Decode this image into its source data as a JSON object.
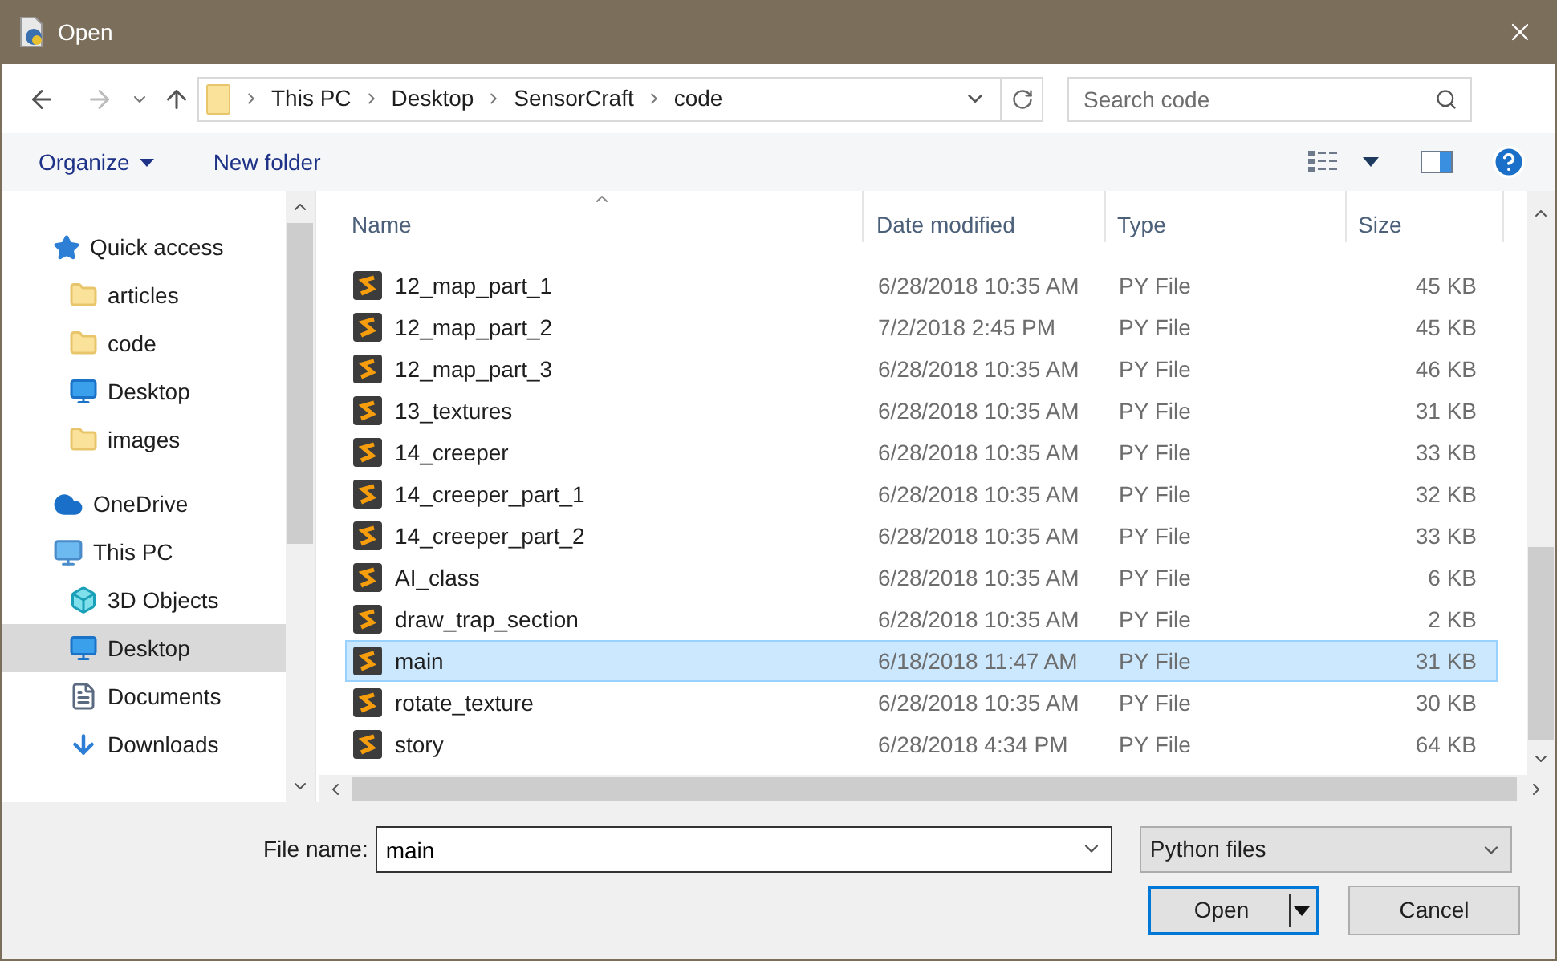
{
  "window": {
    "title": "Open"
  },
  "address": {
    "crumbs": [
      "This PC",
      "Desktop",
      "SensorCraft",
      "code"
    ]
  },
  "search": {
    "placeholder": "Search code"
  },
  "toolbar": {
    "organize": "Organize",
    "new_folder": "New folder"
  },
  "sidebar": {
    "items": [
      {
        "label": "Quick access",
        "kind": "star",
        "selected": false,
        "children": [
          {
            "label": "articles",
            "kind": "folder",
            "selected": false
          },
          {
            "label": "code",
            "kind": "folder",
            "selected": false
          },
          {
            "label": "Desktop",
            "kind": "desktop",
            "selected": false
          },
          {
            "label": "images",
            "kind": "folder",
            "selected": false
          }
        ]
      },
      {
        "label": "OneDrive",
        "kind": "cloud",
        "selected": false
      },
      {
        "label": "This PC",
        "kind": "pc",
        "selected": false,
        "children": [
          {
            "label": "3D Objects",
            "kind": "cube",
            "selected": false
          },
          {
            "label": "Desktop",
            "kind": "desktop",
            "selected": true
          },
          {
            "label": "Documents",
            "kind": "document",
            "selected": false
          },
          {
            "label": "Downloads",
            "kind": "download",
            "selected": false
          }
        ]
      }
    ]
  },
  "table": {
    "columns": [
      "Name",
      "Date modified",
      "Type",
      "Size"
    ],
    "rows": [
      {
        "name": "12_map_part_1",
        "date": "6/28/2018 10:35 AM",
        "type": "PY File",
        "size": "45 KB",
        "selected": false
      },
      {
        "name": "12_map_part_2",
        "date": "7/2/2018 2:45 PM",
        "type": "PY File",
        "size": "45 KB",
        "selected": false
      },
      {
        "name": "12_map_part_3",
        "date": "6/28/2018 10:35 AM",
        "type": "PY File",
        "size": "46 KB",
        "selected": false
      },
      {
        "name": "13_textures",
        "date": "6/28/2018 10:35 AM",
        "type": "PY File",
        "size": "31 KB",
        "selected": false
      },
      {
        "name": "14_creeper",
        "date": "6/28/2018 10:35 AM",
        "type": "PY File",
        "size": "33 KB",
        "selected": false
      },
      {
        "name": "14_creeper_part_1",
        "date": "6/28/2018 10:35 AM",
        "type": "PY File",
        "size": "32 KB",
        "selected": false
      },
      {
        "name": "14_creeper_part_2",
        "date": "6/28/2018 10:35 AM",
        "type": "PY File",
        "size": "33 KB",
        "selected": false
      },
      {
        "name": "AI_class",
        "date": "6/28/2018 10:35 AM",
        "type": "PY File",
        "size": "6 KB",
        "selected": false
      },
      {
        "name": "draw_trap_section",
        "date": "6/28/2018 10:35 AM",
        "type": "PY File",
        "size": "2 KB",
        "selected": false
      },
      {
        "name": "main",
        "date": "6/18/2018 11:47 AM",
        "type": "PY File",
        "size": "31 KB",
        "selected": true
      },
      {
        "name": "rotate_texture",
        "date": "6/28/2018 10:35 AM",
        "type": "PY File",
        "size": "30 KB",
        "selected": false
      },
      {
        "name": "story",
        "date": "6/28/2018 4:34 PM",
        "type": "PY File",
        "size": "64 KB",
        "selected": false
      }
    ]
  },
  "file_name": {
    "label": "File name:",
    "value": "main"
  },
  "file_type": {
    "value": "Python files"
  },
  "buttons": {
    "open": "Open",
    "cancel": "Cancel"
  }
}
